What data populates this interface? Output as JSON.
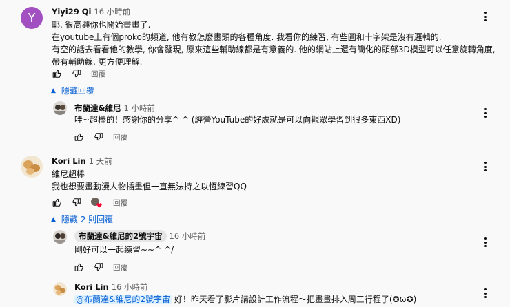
{
  "comments": [
    {
      "author": "Yiyi29 Qi",
      "time": "16 小時前",
      "avatar_letter": "Y",
      "lines": [
        "耶, 很高興你也開始畫畫了.",
        "在youtube上有個proko的頻道, 他有教怎麼畫頭的各種角度. 我看你的練習, 有些圓和十字架是沒有邏輯的.",
        "有空的話去看看他的教學, 你會發現, 原來這些輔助線都是有意義的. 他的網站上還有簡化的頭部3D模型可以任意旋轉角度,",
        "帶有輔助線, 更方便理解."
      ],
      "reply_label": "回覆",
      "toggle_label": "隱藏回覆"
    },
    {
      "author": "布蘭達&維尼",
      "time": "1 小時前",
      "lines": [
        "哇~超棒的！感謝你的分享^ ^ (經營YouTube的好處就是可以向觀眾學習到很多東西XD)"
      ],
      "reply_label": "回覆"
    },
    {
      "author": "Kori Lin",
      "time": "1 天前",
      "lines": [
        "維尼超棒",
        "我也想要畫動漫人物插畫但一直無法持之以恆練習QQ"
      ],
      "reply_label": "回覆",
      "toggle_label": "隱藏 2 則回覆"
    },
    {
      "author": "布蘭達&維尼的2號宇宙",
      "time": "16 小時前",
      "lines": [
        "剛好可以一起練習~~^ ^/"
      ],
      "reply_label": "回覆"
    },
    {
      "author": "Kori Lin",
      "time": "16 小時前",
      "mention": "@布蘭達&維尼的2號宇宙",
      "text_after_mention": " 好！昨天看了影片講設計工作流程～把畫畫排入周三行程了(✪ω✪)"
    }
  ],
  "colors": {
    "link": "#065fd4",
    "avatar_y": "#a14fc1",
    "heart": "#ff0033"
  },
  "icons": [
    "thumb-up-icon",
    "thumb-down-icon",
    "creator-heart-icon",
    "more-vert-icon",
    "caret-up-icon"
  ]
}
